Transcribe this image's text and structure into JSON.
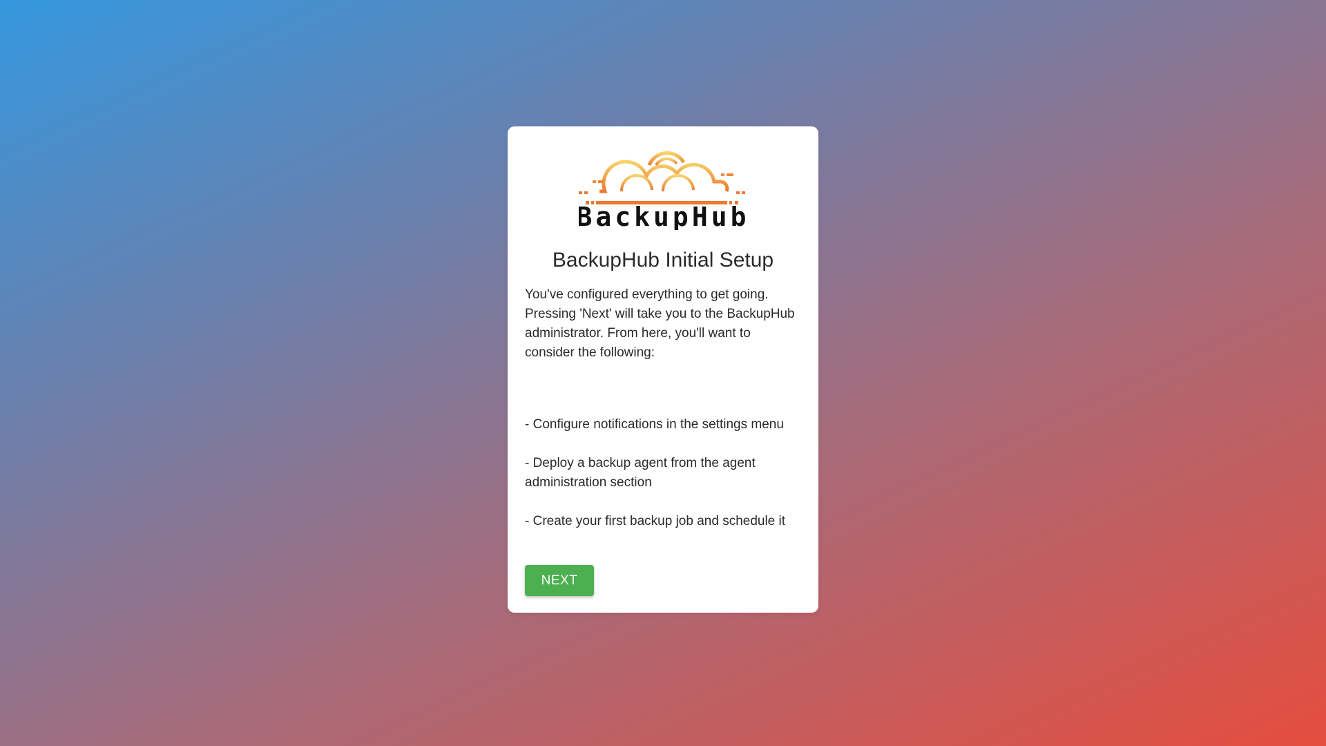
{
  "brand": {
    "logo_text": "BackupHub",
    "logo_icon": "cloud-sun-logo-icon",
    "colors": {
      "logo_top": "#f2c94c",
      "logo_bottom": "#eb7a34",
      "accent": "#4caf50"
    }
  },
  "setup": {
    "title": "BackupHub Initial Setup",
    "intro": "You've configured everything to get going. Pressing 'Next' will take you to the BackupHub administrator. From here, you'll want to consider the following:",
    "steps": [
      "- Configure notifications in the settings menu",
      "- Deploy a backup agent from the agent administration section",
      "- Create your first backup job and schedule it"
    ],
    "next_label": "NEXT"
  }
}
